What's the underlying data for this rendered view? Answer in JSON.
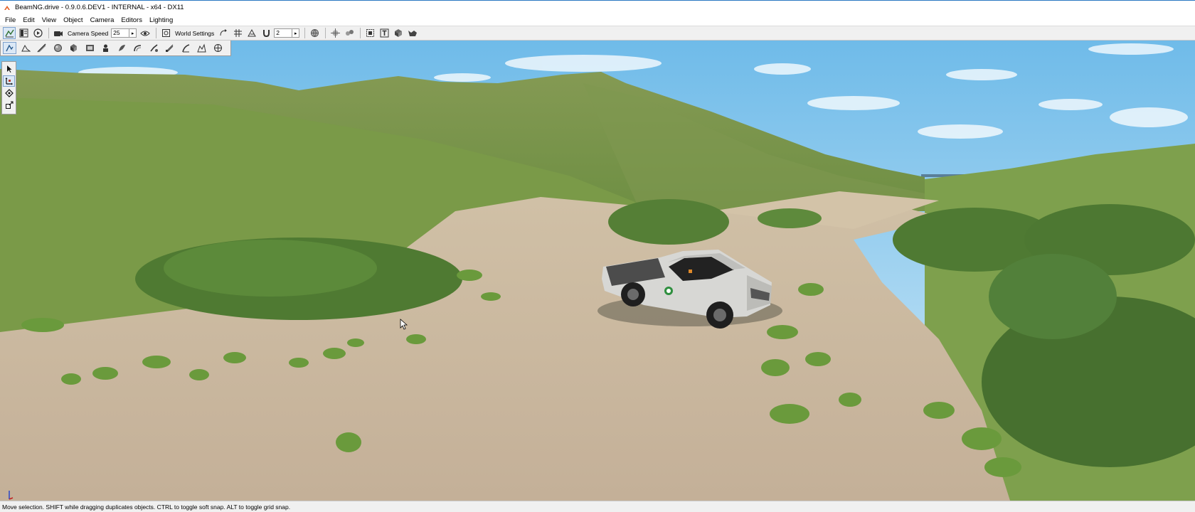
{
  "window": {
    "title": "BeamNG.drive - 0.9.0.6.DEV1 - INTERNAL - x64 - DX11",
    "icon": "beamng-logo-icon"
  },
  "menu": [
    "File",
    "Edit",
    "View",
    "Object",
    "Camera",
    "Editors",
    "Lighting"
  ],
  "toolbar": {
    "camera_speed_label": "Camera Speed",
    "camera_speed_value": "25",
    "world_settings_label": "World Settings",
    "snap_value": "2",
    "left_icons": [
      "world-editor-icon",
      "inspector-icon",
      "play-icon",
      "camera-icon"
    ],
    "right_icons": [
      "snap-rotation-icon",
      "grid-icon",
      "terrain-snap-icon",
      "magnet-icon",
      "globe-icon",
      "object-select-icon",
      "group-icon",
      "bounds-icon",
      "text-icon",
      "objects-icon",
      "flock-icon"
    ]
  },
  "palette": {
    "icons": [
      "object-editor-icon",
      "terrain-editor-icon",
      "road-editor-icon",
      "material-icon",
      "forest-icon",
      "camera-path-icon",
      "prefab-icon",
      "decal-icon",
      "river-icon",
      "mesh-road-icon",
      "meshes-icon",
      "decal-road-icon",
      "navmesh-icon",
      "spline-icon"
    ],
    "active": "object-editor-icon"
  },
  "tools": {
    "icons": [
      "select-arrow-icon",
      "move-gizmo-icon",
      "rotate-gizmo-icon",
      "scale-gizmo-icon"
    ],
    "active": "move-gizmo-icon"
  },
  "viewport": {
    "scene": "terrain-with-white-pickup-truck",
    "colors": {
      "sky_top": "#7ec4ec",
      "sky_bottom": "#d6ecf8",
      "grass": "#6f9a45",
      "dirt": "#c7b49c",
      "truck": "#d7d7d4"
    }
  },
  "status": {
    "text": "Move selection.  SHIFT while dragging duplicates objects.  CTRL to toggle soft snap.  ALT to toggle grid snap."
  }
}
